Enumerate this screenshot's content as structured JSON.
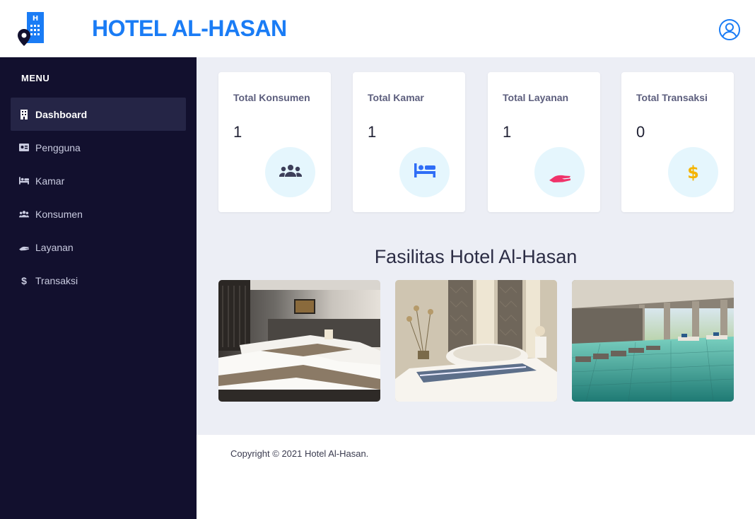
{
  "header": {
    "brand": "HOTEL AL-HASAN",
    "logo_icon": "hotel-location-icon",
    "user_icon": "user-circle-icon",
    "brand_color": "#1a7cf5"
  },
  "sidebar": {
    "menu_title": "MENU",
    "items": [
      {
        "label": "Dashboard",
        "icon": "building-icon",
        "active": true
      },
      {
        "label": "Pengguna",
        "icon": "id-card-icon"
      },
      {
        "label": "Kamar",
        "icon": "bed-icon"
      },
      {
        "label": "Konsumen",
        "icon": "users-icon"
      },
      {
        "label": "Layanan",
        "icon": "hand-icon"
      },
      {
        "label": "Transaksi",
        "icon": "dollar-icon"
      }
    ]
  },
  "cards": [
    {
      "title": "Total Konsumen",
      "value": "1",
      "icon": "users-icon",
      "icon_color": "#3d3f5a"
    },
    {
      "title": "Total Kamar",
      "value": "1",
      "icon": "bed-icon",
      "icon_color": "#2f6df6"
    },
    {
      "title": "Total Layanan",
      "value": "1",
      "icon": "hand-icon",
      "icon_color": "#f0336a"
    },
    {
      "title": "Total Transaksi",
      "value": "0",
      "icon": "dollar-icon",
      "icon_color": "#f5b400"
    }
  ],
  "facilities": {
    "title": "Fasilitas Hotel Al-Hasan",
    "photos": [
      "hotel-room-photo",
      "spa-photo",
      "pool-photo"
    ]
  },
  "footer": {
    "copyright": "Copyright © 2021 Hotel Al-Hasan."
  }
}
